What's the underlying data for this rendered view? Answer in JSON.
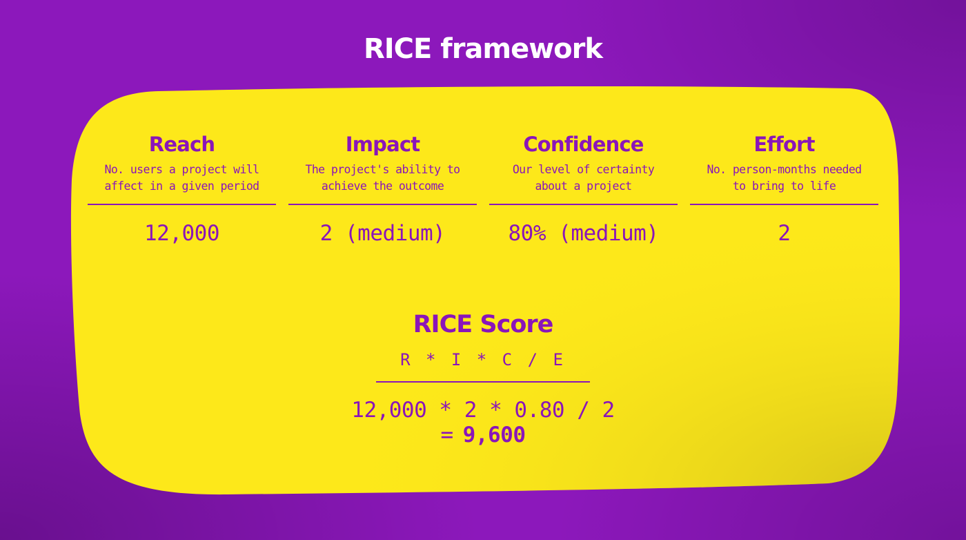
{
  "title": "RICE framework",
  "colors": {
    "background": "#8c18bb",
    "card": "#fde81a",
    "text_primary": "#8a15b9",
    "title_text": "#ffffff"
  },
  "metrics": [
    {
      "name": "Reach",
      "description": "No. users a project will\naffect in a given period",
      "value": "12,000"
    },
    {
      "name": "Impact",
      "description": "The project's ability to\nachieve the outcome",
      "value": "2 (medium)"
    },
    {
      "name": "Confidence",
      "description": "Our level of certainty\nabout a project",
      "value": "80% (medium)"
    },
    {
      "name": "Effort",
      "description": "No. person-months needed\nto bring to life",
      "value": "2"
    }
  ],
  "score": {
    "title": "RICE Score",
    "formula": "R * I * C / E",
    "calculation": "12,000 * 2 * 0.80 / 2",
    "equals": "=",
    "result": "9,600"
  }
}
